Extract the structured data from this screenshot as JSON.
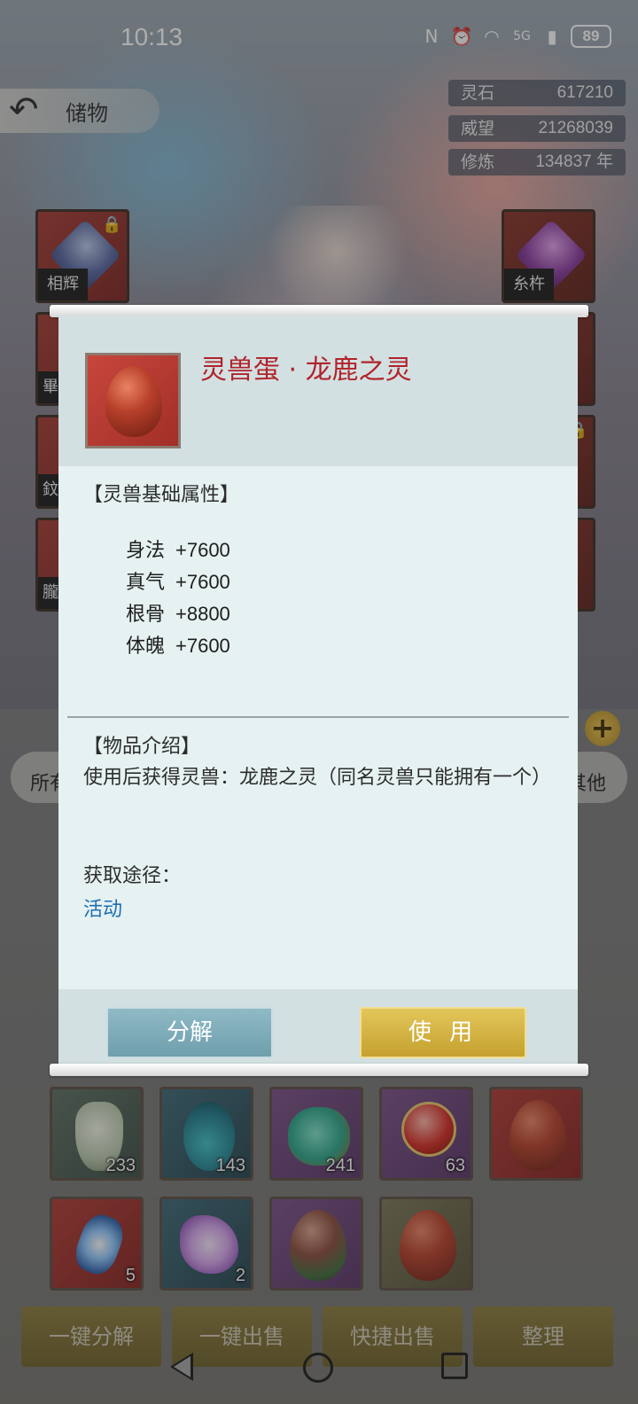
{
  "status_bar": {
    "time": "10:13",
    "network": "5G",
    "battery": "89",
    "icons": [
      "nfc-icon",
      "alarm-icon",
      "wifi-icon",
      "signal-icon"
    ]
  },
  "header": {
    "title": "储物",
    "currencies": [
      {
        "label": "灵石",
        "value": "617210"
      },
      {
        "label": "威望",
        "value": "21268039"
      },
      {
        "label": "修炼",
        "value": "134837 年"
      }
    ]
  },
  "equipment": {
    "seals": [
      "相辉",
      "畢",
      "鈫",
      "朧",
      "糸杵"
    ]
  },
  "inventory": {
    "tab_first": "所有",
    "tab_last": "其他",
    "items": [
      {
        "icon": "vase-icon",
        "count": "233",
        "color": "#5b6e62"
      },
      {
        "icon": "gourd-icon",
        "count": "143",
        "color": "#3c6876"
      },
      {
        "icon": "jar-icon",
        "count": "241",
        "color": "#7a4f86"
      },
      {
        "icon": "orb-icon",
        "count": "63",
        "color": "#7a4f86"
      },
      {
        "icon": "red-egg-icon",
        "count": "",
        "color": "#b13a34"
      },
      {
        "icon": "crystal-icon",
        "count": "5",
        "color": "#b13a34"
      },
      {
        "icon": "flower-icon",
        "count": "2",
        "color": "#3c6876"
      },
      {
        "icon": "multicolor-egg-icon",
        "count": "",
        "color": "#7a4f86"
      },
      {
        "icon": "red-egg-icon",
        "count": "",
        "color": "#7a7556"
      }
    ]
  },
  "action_bar": {
    "decompose_all": "一键分解",
    "sell_all": "一键出售",
    "quick_sell": "快捷出售",
    "organize": "整理"
  },
  "modal": {
    "item_name": "灵兽蛋 · 龙鹿之灵",
    "attr_section_title": "【灵兽基础属性】",
    "attributes": [
      {
        "name": "身法",
        "value": "+7600"
      },
      {
        "name": "真气",
        "value": "+7600"
      },
      {
        "name": "根骨",
        "value": "+8800"
      },
      {
        "name": "体魄",
        "value": "+7600"
      }
    ],
    "intro_section_title": "【物品介绍】",
    "intro_text": "使用后获得灵兽：龙鹿之灵（同名灵兽只能拥有一个）",
    "source_label": "获取途径：",
    "source_value": "活动",
    "decompose_button": "分解",
    "use_button": "使 用",
    "colors": {
      "title": "#b0242a",
      "link": "#1e6fb0",
      "use_button": "#d4b445",
      "decompose_button": "#7fabb8"
    }
  }
}
